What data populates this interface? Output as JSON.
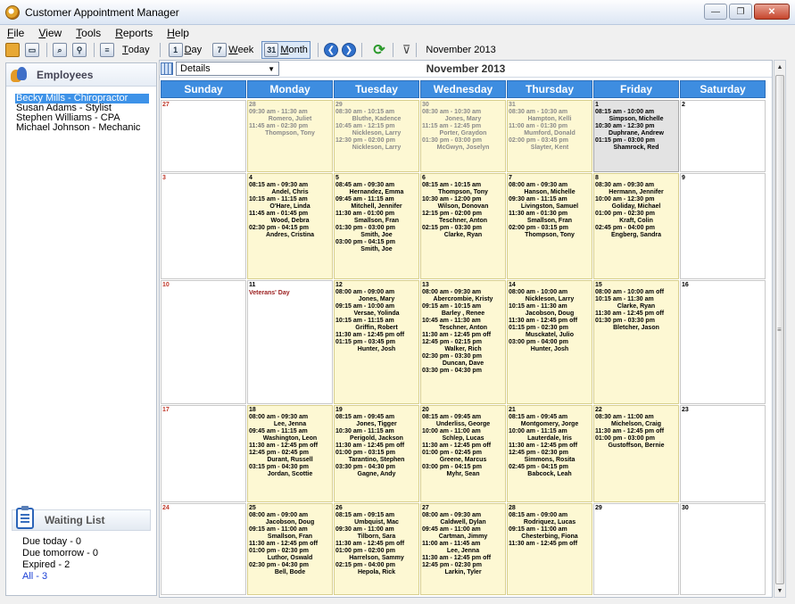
{
  "window": {
    "title": "Customer Appointment Manager"
  },
  "menu": [
    {
      "label": "File",
      "key": "F",
      "rest": "ile"
    },
    {
      "label": "View",
      "key": "V",
      "rest": "iew"
    },
    {
      "label": "Tools",
      "key": "T",
      "rest": "ools"
    },
    {
      "label": "Reports",
      "key": "R",
      "rest": "eports"
    },
    {
      "label": "Help",
      "key": "H",
      "rest": "elp"
    }
  ],
  "toolbar": {
    "today": {
      "key": "T",
      "rest": "oday"
    },
    "day": {
      "icon_text": "1",
      "key": "D",
      "rest": "ay"
    },
    "week": {
      "icon_text": "7",
      "key": "W",
      "rest": "eek"
    },
    "month": {
      "icon_text": "31",
      "key": "M",
      "rest": "onth"
    },
    "month_label": "November 2013"
  },
  "sidebar": {
    "employees_title": "Employees",
    "employees": [
      "Becky Mills - Chiropractor",
      "Susan Adams - Stylist",
      "Stephen Williams - CPA",
      "Michael Johnson - Mechanic"
    ],
    "selected_index": 0,
    "waiting_title": "Waiting List",
    "waiting": [
      {
        "label": "Due today - 0",
        "link": false
      },
      {
        "label": "Due tomorrow - 0",
        "link": false
      },
      {
        "label": "Expired - 2",
        "link": false
      },
      {
        "label": "All - 3",
        "link": true
      }
    ]
  },
  "calendar": {
    "view_option": "Details",
    "title": "November 2013",
    "day_names": [
      "Sunday",
      "Monday",
      "Tuesday",
      "Wednesday",
      "Thursday",
      "Friday",
      "Saturday"
    ],
    "weeks": [
      [
        {
          "day": "27",
          "appts": []
        },
        {
          "day": "28",
          "past": true,
          "appts": [
            {
              "t": "09:30 am - 11:30 am",
              "n": "Romero, Juliet"
            },
            {
              "t": "11:45 am - 02:30 pm",
              "n": "Thompson, Tony"
            }
          ]
        },
        {
          "day": "29",
          "past": true,
          "appts": [
            {
              "t": "08:30 am - 10:15 am",
              "n": "Bluthe, Kadence"
            },
            {
              "t": "10:45 am - 12:15 pm",
              "n": "Nickleson, Larry"
            },
            {
              "t": "12:30 pm - 02:00 pm",
              "n": "Nickleson, Larry"
            }
          ]
        },
        {
          "day": "30",
          "past": true,
          "appts": [
            {
              "t": "08:30 am - 10:30 am",
              "n": "Jones, Mary"
            },
            {
              "t": "11:15 am - 12:45 pm",
              "n": "Porter, Graydon"
            },
            {
              "t": "01:30 pm - 03:00 pm",
              "n": "McGwyn, Joselyn"
            }
          ]
        },
        {
          "day": "31",
          "past": true,
          "appts": [
            {
              "t": "08:30 am - 10:30 am",
              "n": "Hampton, Kelli"
            },
            {
              "t": "11:00 am - 01:30 pm",
              "n": "Mumford, Donald"
            },
            {
              "t": "02:00 pm - 03:45 pm",
              "n": "Slayter, Kent"
            }
          ]
        },
        {
          "day": "1",
          "today": true,
          "appts": [
            {
              "t": "08:15 am - 10:00 am",
              "n": "Simpson, Michelle"
            },
            {
              "t": "10:30 am - 12:30 pm",
              "n": "Duphrane, Andrew"
            },
            {
              "t": "01:15 pm - 03:00 pm",
              "n": "Shamrock, Red"
            }
          ]
        },
        {
          "day": "2",
          "appts": []
        }
      ],
      [
        {
          "day": "3",
          "appts": []
        },
        {
          "day": "4",
          "appts": [
            {
              "t": "08:15 am - 09:30 am",
              "n": "Andel, Chris"
            },
            {
              "t": "10:15 am - 11:15 am",
              "n": "O'Hare, Linda"
            },
            {
              "t": "11:45 am - 01:45 pm",
              "n": "Wood, Debra"
            },
            {
              "t": "02:30 pm - 04:15 pm",
              "n": "Andres, Cristina"
            }
          ]
        },
        {
          "day": "5",
          "appts": [
            {
              "t": "08:45 am - 09:30 am",
              "n": "Hernandez, Emma"
            },
            {
              "t": "09:45 am - 11:15 am",
              "n": "Mitchell, Jennifer"
            },
            {
              "t": "11:30 am - 01:00 pm",
              "n": "Smallson, Fran"
            },
            {
              "t": "01:30 pm - 03:00 pm",
              "n": "Smith, Joe"
            },
            {
              "t": "03:00 pm - 04:15 pm",
              "n": "Smith, Joe"
            }
          ]
        },
        {
          "day": "6",
          "appts": [
            {
              "t": "08:15 am - 10:15 am",
              "n": "Thompson, Tony"
            },
            {
              "t": "10:30 am - 12:00 pm",
              "n": "Wilson, Donovan"
            },
            {
              "t": "12:15 pm - 02:00 pm",
              "n": "Teschner, Anton"
            },
            {
              "t": "02:15 pm - 03:30 pm",
              "n": "Clarke, Ryan"
            }
          ]
        },
        {
          "day": "7",
          "appts": [
            {
              "t": "08:00 am - 09:30 am",
              "n": "Hanson, Michelle"
            },
            {
              "t": "09:30 am - 11:15 am",
              "n": "Livingston, Samuel"
            },
            {
              "t": "11:30 am - 01:30 pm",
              "n": "Smallson, Fran"
            },
            {
              "t": "02:00 pm - 03:15 pm",
              "n": "Thompson, Tony"
            }
          ]
        },
        {
          "day": "8",
          "appts": [
            {
              "t": "08:30 am - 09:30 am",
              "n": "Hermann, Jennifer"
            },
            {
              "t": "10:00 am - 12:30 pm",
              "n": "Goliday, Michael"
            },
            {
              "t": "01:00 pm - 02:30 pm",
              "n": "Kraft, Colin"
            },
            {
              "t": "02:45 pm - 04:00 pm",
              "n": "Engberg, Sandra"
            }
          ]
        },
        {
          "day": "9",
          "appts": []
        }
      ],
      [
        {
          "day": "10",
          "appts": []
        },
        {
          "day": "11",
          "holiday": "Veterans' Day",
          "plain": true,
          "appts": []
        },
        {
          "day": "12",
          "appts": [
            {
              "t": "08:00 am - 09:00 am",
              "n": "Jones, Mary"
            },
            {
              "t": "09:15 am - 10:00 am",
              "n": "Versae, Yolinda"
            },
            {
              "t": "10:15 am - 11:15 am",
              "n": "Griffin, Robert"
            },
            {
              "t": "11:30 am - 12:45 pm off",
              "n": ""
            },
            {
              "t": "01:15 pm - 03:45 pm",
              "n": "Hunter, Josh"
            }
          ]
        },
        {
          "day": "13",
          "appts": [
            {
              "t": "08:00 am - 09:30 am",
              "n": "Abercrombie, Kristy"
            },
            {
              "t": "09:15 am - 10:15 am",
              "n": "Barley , Renee"
            },
            {
              "t": "10:45 am - 11:30 am",
              "n": "Teschner, Anton"
            },
            {
              "t": "11:30 am - 12:45 pm off",
              "n": ""
            },
            {
              "t": "12:45 pm - 02:15 pm",
              "n": "Walker, Rich"
            },
            {
              "t": "02:30 pm - 03:30 pm",
              "n": "Duncan, Dave"
            },
            {
              "t": "03:30 pm - 04:30 pm",
              "n": ""
            }
          ]
        },
        {
          "day": "14",
          "appts": [
            {
              "t": "08:00 am - 10:00 am",
              "n": "Nickleson, Larry"
            },
            {
              "t": "10:15 am - 11:30 am",
              "n": "Jacobson, Doug"
            },
            {
              "t": "11:30 am - 12:45 pm off",
              "n": ""
            },
            {
              "t": "01:15 pm - 02:30 pm",
              "n": "Musckatel, Julio"
            },
            {
              "t": "03:00 pm - 04:00 pm",
              "n": "Hunter, Josh"
            }
          ]
        },
        {
          "day": "15",
          "appts": [
            {
              "t": "08:00 am - 10:00 am off",
              "n": ""
            },
            {
              "t": "10:15 am - 11:30 am",
              "n": "Clarke, Ryan"
            },
            {
              "t": "11:30 am - 12:45 pm off",
              "n": ""
            },
            {
              "t": "01:30 pm - 03:30 pm",
              "n": "Bletcher, Jason"
            }
          ]
        },
        {
          "day": "16",
          "appts": []
        }
      ],
      [
        {
          "day": "17",
          "appts": []
        },
        {
          "day": "18",
          "appts": [
            {
              "t": "08:00 am - 09:30 am",
              "n": "Lee, Jenna"
            },
            {
              "t": "09:45 am - 11:15 am",
              "n": "Washington, Leon"
            },
            {
              "t": "11:30 am - 12:45 pm off",
              "n": ""
            },
            {
              "t": "12:45 pm - 02:45 pm",
              "n": "Durant, Russell"
            },
            {
              "t": "03:15 pm - 04:30 pm",
              "n": "Jordan, Scottie"
            }
          ]
        },
        {
          "day": "19",
          "appts": [
            {
              "t": "08:15 am - 09:45 am",
              "n": "Jones, Tigger"
            },
            {
              "t": "10:30 am - 11:15 am",
              "n": "Perigold, Jackson"
            },
            {
              "t": "11:30 am - 12:45 pm off",
              "n": ""
            },
            {
              "t": "01:00 pm - 03:15 pm",
              "n": "Tarantino, Stephen"
            },
            {
              "t": "03:30 pm - 04:30 pm",
              "n": "Gagne, Andy"
            }
          ]
        },
        {
          "day": "20",
          "appts": [
            {
              "t": "08:15 am - 09:45 am",
              "n": "Underliss, George"
            },
            {
              "t": "10:00 am - 11:00 am",
              "n": "Schlep, Lucas"
            },
            {
              "t": "11:30 am - 12:45 pm off",
              "n": ""
            },
            {
              "t": "01:00 pm - 02:45 pm",
              "n": "Greene, Marcus"
            },
            {
              "t": "03:00 pm - 04:15 pm",
              "n": "Myhr, Sean"
            }
          ]
        },
        {
          "day": "21",
          "appts": [
            {
              "t": "08:15 am - 09:45 am",
              "n": "Montgomery, Jorge"
            },
            {
              "t": "10:00 am - 11:15 am",
              "n": "Lauterdale, Iris"
            },
            {
              "t": "11:30 am - 12:45 pm off",
              "n": ""
            },
            {
              "t": "12:45 pm - 02:30 pm",
              "n": "Simmons, Rosita"
            },
            {
              "t": "02:45 pm - 04:15 pm",
              "n": "Babcock, Leah"
            }
          ]
        },
        {
          "day": "22",
          "appts": [
            {
              "t": "08:30 am - 11:00 am",
              "n": "Michelson, Craig"
            },
            {
              "t": "11:30 am - 12:45 pm off",
              "n": ""
            },
            {
              "t": "01:00 pm - 03:00 pm",
              "n": "Gustoffson, Bernie"
            }
          ]
        },
        {
          "day": "23",
          "appts": []
        }
      ],
      [
        {
          "day": "24",
          "appts": []
        },
        {
          "day": "25",
          "appts": [
            {
              "t": "08:00 am - 09:00 am",
              "n": "Jacobson, Doug"
            },
            {
              "t": "09:15 am - 11:00 am",
              "n": "Smallson, Fran"
            },
            {
              "t": "11:30 am - 12:45 pm off",
              "n": ""
            },
            {
              "t": "01:00 pm - 02:30 pm",
              "n": "Luthor, Oswald"
            },
            {
              "t": "02:30 pm - 04:30 pm",
              "n": "Bell, Bode"
            }
          ]
        },
        {
          "day": "26",
          "appts": [
            {
              "t": "08:15 am - 09:15 am",
              "n": "Umbquist, Mac"
            },
            {
              "t": "09:30 am - 11:00 am",
              "n": "Tilborn, Sara"
            },
            {
              "t": "11:30 am - 12:45 pm off",
              "n": ""
            },
            {
              "t": "01:00 pm - 02:00 pm",
              "n": "Harrelson, Sammy"
            },
            {
              "t": "02:15 pm - 04:00 pm",
              "n": "Hepola, Rick"
            }
          ]
        },
        {
          "day": "27",
          "appts": [
            {
              "t": "08:00 am - 09:30 am",
              "n": "Caldwell, Dylan"
            },
            {
              "t": "09:45 am - 11:00 am",
              "n": "Cartman, Jimmy"
            },
            {
              "t": "11:00 am - 11:45 am",
              "n": "Lee, Jenna"
            },
            {
              "t": "11:30 am - 12:45 pm off",
              "n": ""
            },
            {
              "t": "12:45 pm - 02:30 pm",
              "n": "Larkin, Tyler"
            }
          ]
        },
        {
          "day": "28",
          "appts": [
            {
              "t": "08:15 am - 09:00 am",
              "n": "Rodriquez, Lucas"
            },
            {
              "t": "09:15 am - 11:00 am",
              "n": "Chesterbing, Fiona"
            },
            {
              "t": "11:30 am - 12:45 pm off",
              "n": ""
            }
          ]
        },
        {
          "day": "29",
          "appts": []
        },
        {
          "day": "30",
          "appts": []
        }
      ]
    ]
  }
}
